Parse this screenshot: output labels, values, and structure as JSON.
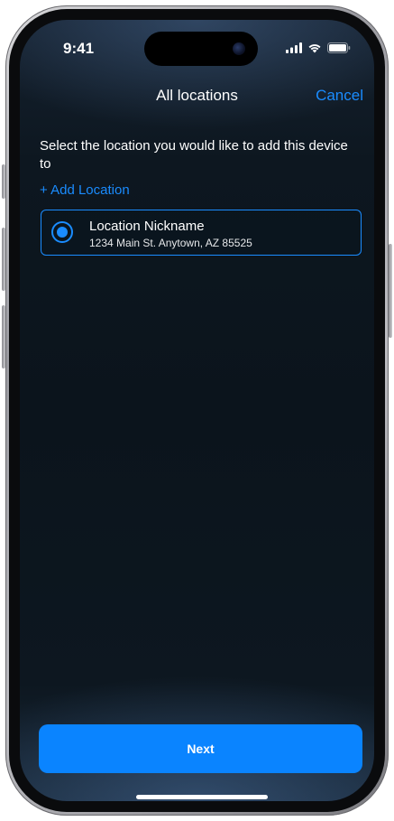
{
  "status_bar": {
    "time": "9:41",
    "icons": [
      "signal-icon",
      "wifi-icon",
      "battery-icon"
    ]
  },
  "nav": {
    "title": "All locations",
    "cancel_label": "Cancel"
  },
  "content": {
    "prompt": "Select the location you would like to add this device to",
    "add_location_label": "+ Add Location",
    "locations": [
      {
        "name": "Location Nickname",
        "address": "1234 Main St. Anytown, AZ 85525",
        "selected": true
      }
    ]
  },
  "footer": {
    "next_label": "Next"
  },
  "colors": {
    "accent": "#1a8cff",
    "button": "#0a84ff",
    "background": "#0b141c",
    "text": "#ffffff"
  }
}
